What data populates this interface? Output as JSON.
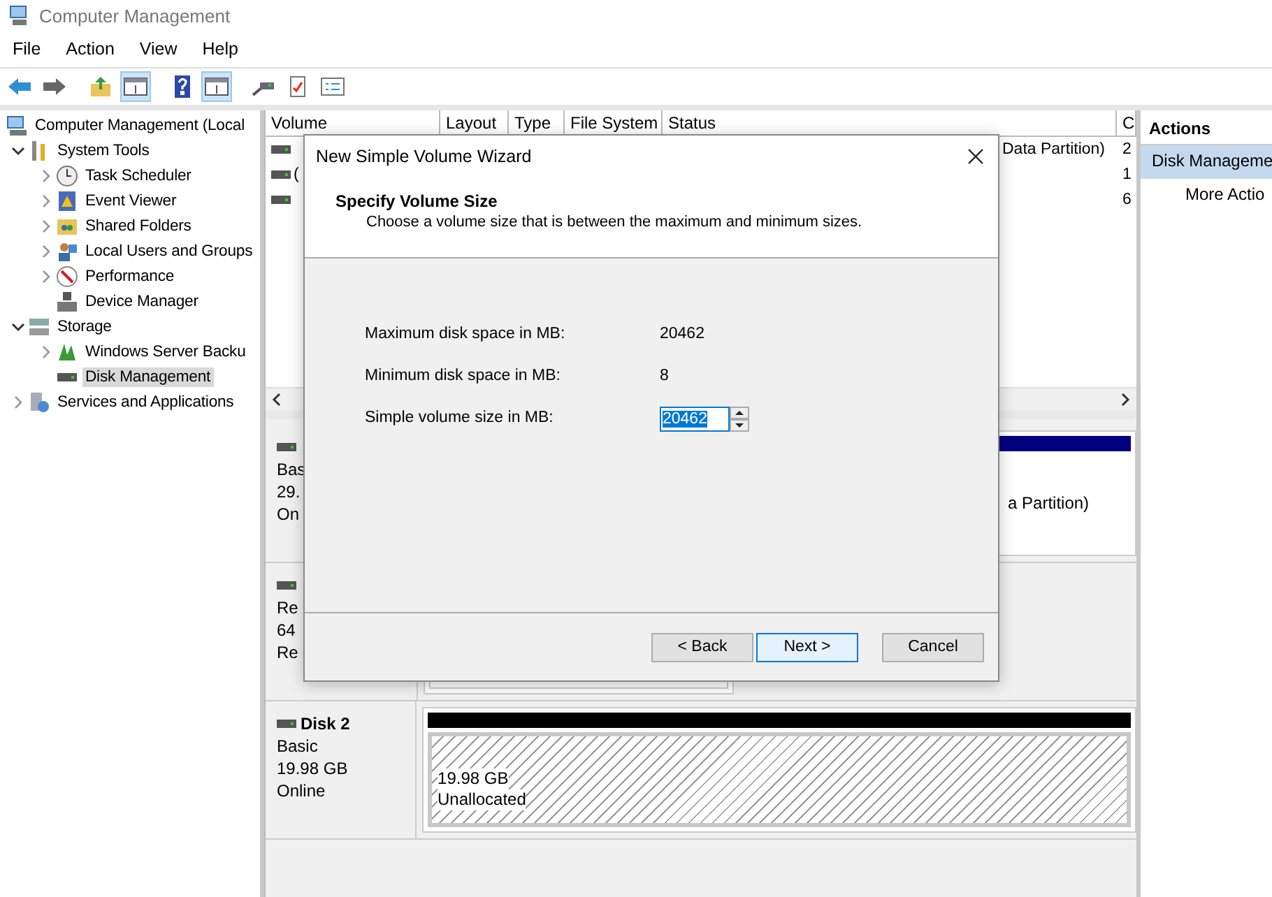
{
  "window": {
    "title": "Computer Management"
  },
  "menu": [
    "File",
    "Action",
    "View",
    "Help"
  ],
  "toolbar": [
    {
      "pressed": false
    },
    {
      "pressed": false
    },
    {
      "pressed": false
    },
    {
      "pressed": true
    },
    {
      "pressed": false
    },
    {
      "pressed": true
    },
    {
      "pressed": false
    },
    {
      "pressed": false
    },
    {
      "pressed": false
    }
  ],
  "tree": [
    {
      "label": "Computer Management (Local",
      "kind": "root",
      "selected": false,
      "children": [
        {
          "label": "System Tools",
          "kind": "branch",
          "expanded": true,
          "selected": false,
          "children": [
            {
              "label": "Task Scheduler",
              "kind": "branch",
              "expanded": false,
              "selected": false
            },
            {
              "label": "Event Viewer",
              "kind": "branch",
              "expanded": false,
              "selected": false
            },
            {
              "label": "Shared Folders",
              "kind": "branch",
              "expanded": false,
              "selected": false
            },
            {
              "label": "Local Users and Groups",
              "kind": "branch",
              "expanded": false,
              "selected": false
            },
            {
              "label": "Performance",
              "kind": "branch",
              "expanded": false,
              "selected": false
            },
            {
              "label": "Device Manager",
              "kind": "leaf",
              "selected": false
            }
          ]
        },
        {
          "label": "Storage",
          "kind": "branch",
          "expanded": true,
          "selected": false,
          "children": [
            {
              "label": "Windows Server Backu",
              "kind": "branch",
              "expanded": false,
              "selected": false
            },
            {
              "label": "Disk Management",
              "kind": "leaf",
              "selected": true
            }
          ]
        },
        {
          "label": "Services and Applications",
          "kind": "branch",
          "expanded": false,
          "selected": false
        }
      ]
    }
  ],
  "volume_table": {
    "columns": [
      "Volume",
      "Layout",
      "Type",
      "File System",
      "Status",
      "C"
    ],
    "rows": [
      {
        "status": "Data Partition)",
        "capacity": "2"
      },
      {
        "volume": "(",
        "capacity": "1"
      },
      {
        "capacity": "6"
      }
    ]
  },
  "disks": [
    {
      "lines": [
        "Bas",
        "29.",
        "On"
      ],
      "partition": {
        "kind": "primary",
        "lines": [
          "a Partition)"
        ]
      }
    },
    {
      "lines": [
        "Re",
        "64",
        "Re"
      ],
      "partition": {
        "kind": "plain"
      }
    },
    {
      "name": "Disk 2",
      "lines": [
        "Basic",
        "19.98 GB",
        "Online"
      ],
      "partition": {
        "kind": "unallocated",
        "lines": [
          "19.98 GB",
          "Unallocated"
        ]
      }
    }
  ],
  "actions": {
    "title": "Actions",
    "items": [
      {
        "label": "Disk Manageme",
        "selected": true
      },
      {
        "label": "More Actio",
        "selected": false
      }
    ]
  },
  "dialog": {
    "title": "New Simple Volume Wizard",
    "heading": "Specify Volume Size",
    "subtitle": "Choose a volume size that is between the maximum and minimum sizes.",
    "fields": [
      {
        "label": "Maximum disk space in MB:",
        "value": "20462",
        "kind": "text"
      },
      {
        "label": "Minimum disk space in MB:",
        "value": "8",
        "kind": "text"
      },
      {
        "label": "Simple volume size in MB:",
        "value": "20462",
        "kind": "spin"
      }
    ],
    "buttons": [
      {
        "label": "< Back",
        "default": false
      },
      {
        "label": "Next >",
        "default": true
      },
      {
        "label": "Cancel",
        "default": false
      }
    ]
  }
}
